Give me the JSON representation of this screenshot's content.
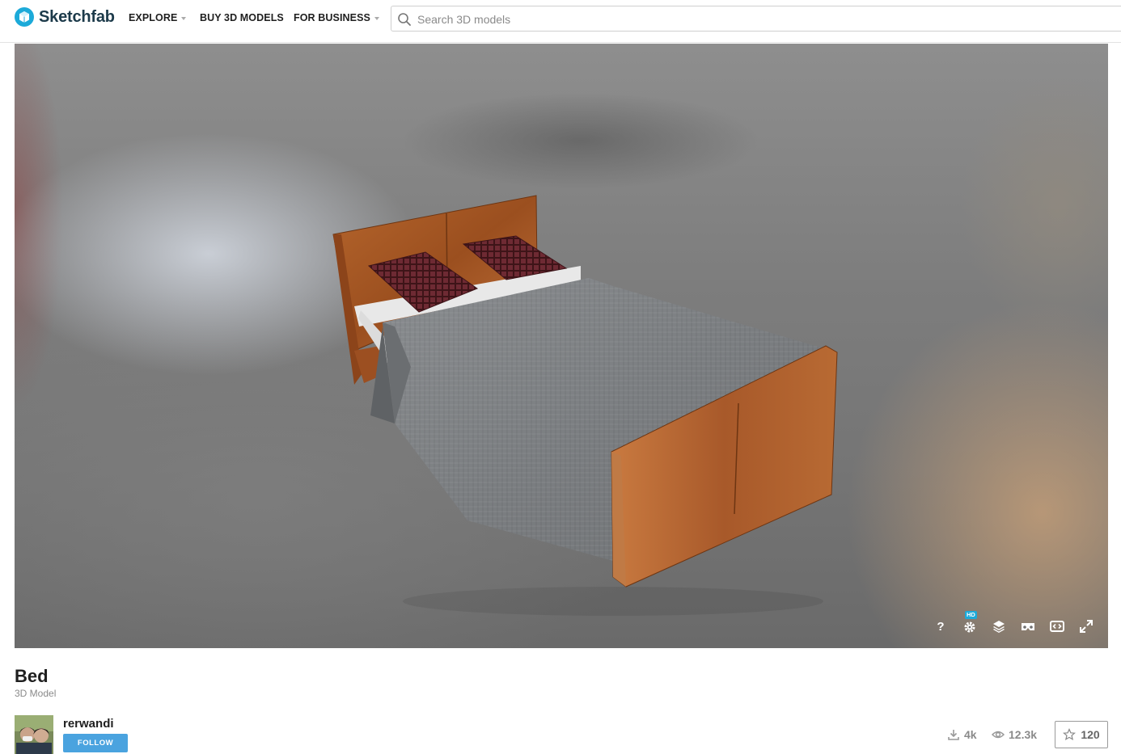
{
  "header": {
    "logo": {
      "text": "Sketchfab",
      "icon": "sketchfab-logo-icon"
    },
    "nav": [
      {
        "label": "EXPLORE",
        "has_dropdown": true
      },
      {
        "label": "BUY 3D MODELS",
        "has_dropdown": false
      },
      {
        "label": "FOR BUSINESS",
        "has_dropdown": true
      }
    ],
    "search": {
      "placeholder": "Search 3D models",
      "value": "",
      "icon": "search-icon"
    }
  },
  "viewer": {
    "controls": [
      {
        "name": "help",
        "icon": "question-icon"
      },
      {
        "name": "settings",
        "icon": "gear-icon",
        "badge": "HD"
      },
      {
        "name": "layers",
        "icon": "layers-icon"
      },
      {
        "name": "vr",
        "icon": "vr-headset-icon"
      },
      {
        "name": "embed",
        "icon": "embed-icon"
      },
      {
        "name": "fullscreen",
        "icon": "fullscreen-icon"
      }
    ]
  },
  "model": {
    "title": "Bed",
    "subtitle": "3D Model",
    "author": {
      "name": "rerwandi",
      "follow_label": "FOLLOW"
    },
    "stats": {
      "downloads": "4k",
      "views": "12.3k",
      "likes": "120"
    }
  },
  "colors": {
    "brand": "#1caad9",
    "follow_button": "#4aa3df",
    "logo_text": "#1c3a4a"
  }
}
